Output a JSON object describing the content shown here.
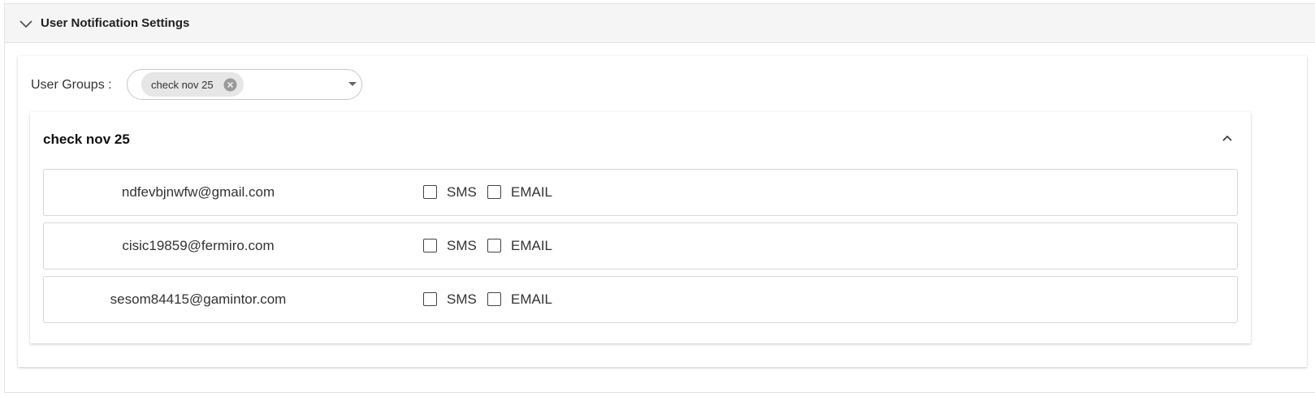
{
  "panel": {
    "title": "User Notification Settings",
    "expand_icon": "chevron-down-icon"
  },
  "user_groups": {
    "label": "User Groups :",
    "selected": [
      {
        "label": "check nov 25",
        "remove_icon": "close-circle-icon"
      }
    ],
    "dropdown_icon": "caret-down-icon"
  },
  "group": {
    "title": "check nov 25",
    "collapse_icon": "chevron-up-icon",
    "users": [
      {
        "email": "ndfevbjnwfw@gmail.com",
        "sms_label": "SMS",
        "sms_checked": false,
        "email_label": "EMAIL",
        "email_checked": false
      },
      {
        "email": "cisic19859@fermiro.com",
        "sms_label": "SMS",
        "sms_checked": false,
        "email_label": "EMAIL",
        "email_checked": false
      },
      {
        "email": "sesom84415@gamintor.com",
        "sms_label": "SMS",
        "sms_checked": false,
        "email_label": "EMAIL",
        "email_checked": false
      }
    ]
  }
}
